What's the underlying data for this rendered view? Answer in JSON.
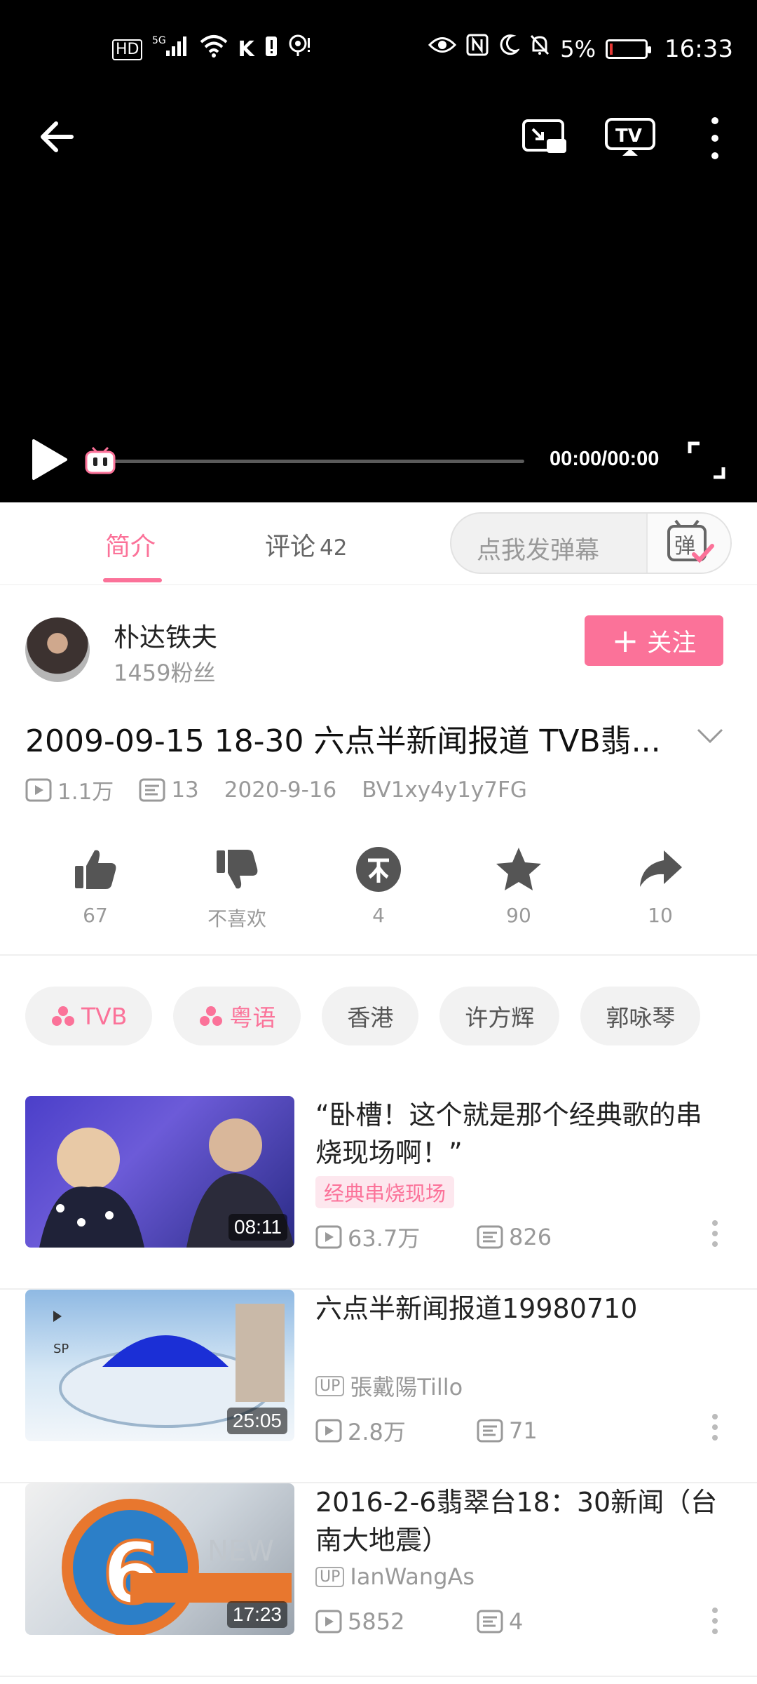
{
  "status_bar": {
    "left_icons": [
      "HD",
      "5G",
      "wifi-icon",
      "k-icon",
      "battery-alert-icon",
      "location-icon"
    ],
    "battery_percent": "5%",
    "time": "16:33"
  },
  "player": {
    "time": "00:00/00:00",
    "progress": 0
  },
  "tabs": {
    "intro": "简介",
    "comments": "评论",
    "comments_count": "42",
    "danmaku_placeholder": "点我发弹幕",
    "danmaku_icon_text": "弹"
  },
  "author": {
    "name": "朴达铁夫",
    "fans": "1459粉丝",
    "follow_label": "关注"
  },
  "video": {
    "title": "2009-09-15 18-30 六点半新闻报道 TVB翡...",
    "views": "1.1万",
    "danmaku": "13",
    "date": "2020-9-16",
    "bvid": "BV1xy4y1y7FG"
  },
  "actions": {
    "like": "67",
    "dislike": "不喜欢",
    "coin": "4",
    "favorite": "90",
    "share": "10"
  },
  "tags": [
    {
      "label": "TVB"
    },
    {
      "label": "粤语"
    },
    {
      "label": "香港"
    },
    {
      "label": "许方辉"
    },
    {
      "label": "郭咏琴"
    }
  ],
  "related": [
    {
      "title": "“卧槽！这个就是那个经典歌的串烧现场啊！”",
      "badge": "经典串烧现场",
      "duration": "08:11",
      "views": "63.7万",
      "danmaku": "826"
    },
    {
      "title": "六点半新闻报道19980710",
      "up_label": "UP",
      "uploader": "張戴陽Tillo",
      "duration": "25:05",
      "views": "2.8万",
      "danmaku": "71"
    },
    {
      "title": "2016-2-6翡翠台18：30新闻（台南大地震）",
      "up_label": "UP",
      "uploader": "IanWangAs",
      "duration": "17:23",
      "views": "5852",
      "danmaku": "4"
    }
  ],
  "colors": {
    "accent": "#fb7299",
    "player_bg": "#000000"
  }
}
